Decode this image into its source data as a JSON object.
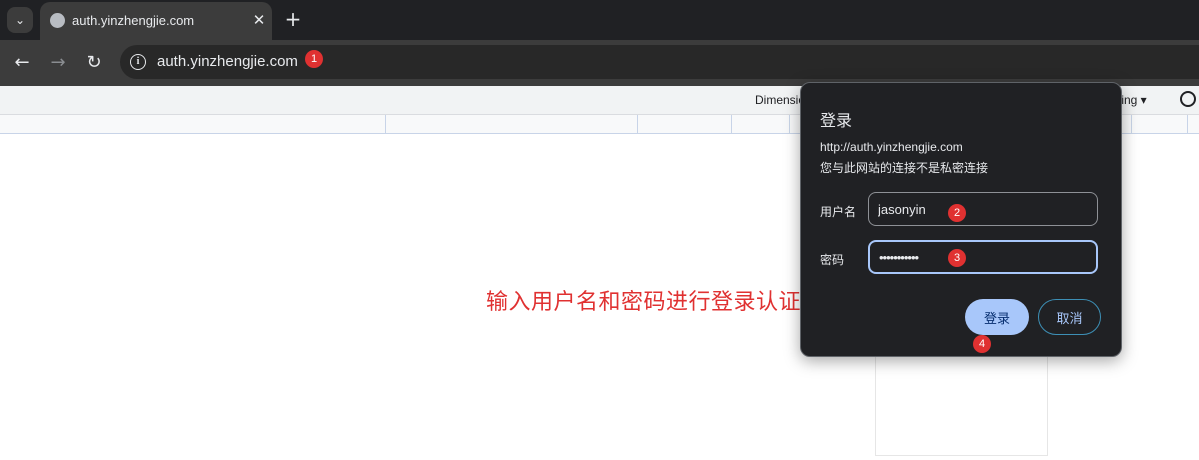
{
  "browser": {
    "tab": {
      "title": "auth.yinzhengjie.com"
    },
    "url": "auth.yinzhengjie.com"
  },
  "devtools": {
    "dimension_label": "Dimensio",
    "throttling_label": "ttling ▾"
  },
  "annotation": {
    "text": "输入用户名和密码进行登录认证即可!"
  },
  "steps": [
    "1",
    "2",
    "3",
    "4"
  ],
  "dialog": {
    "title": "登录",
    "site_url": "http://auth.yinzhengjie.com",
    "warning": "您与此网站的连接不是私密连接",
    "username_label": "用户名",
    "username_value": "jasonyin",
    "password_label": "密码",
    "password_mask": "•••••••••••",
    "login_button": "登录",
    "cancel_button": "取消"
  },
  "colors": {
    "accent": "#a8c7fa",
    "badge": "#e03131",
    "annotation": "#e03131"
  }
}
